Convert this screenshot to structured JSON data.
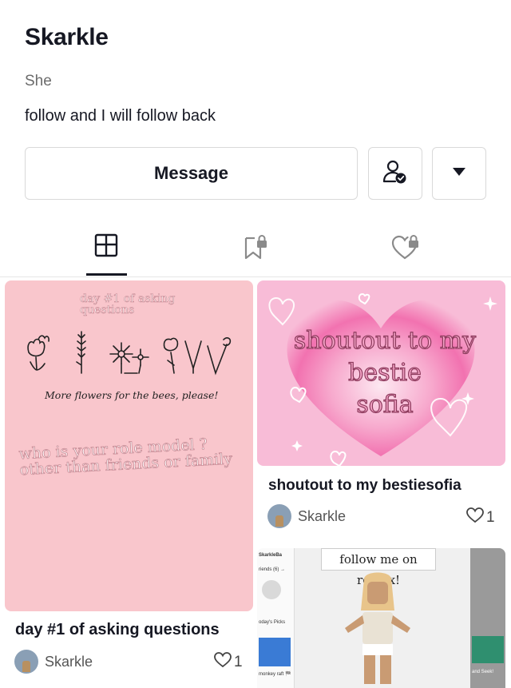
{
  "profile": {
    "name": "Skarkle",
    "pronoun": "She",
    "bio": "follow and I will follow back"
  },
  "actions": {
    "message_label": "Message",
    "friend_icon": "user-check-icon",
    "more_icon": "caret-down-icon"
  },
  "tabs": [
    {
      "icon": "grid-icon",
      "active": true
    },
    {
      "icon": "bookmark-lock-icon",
      "active": false
    },
    {
      "icon": "heart-lock-icon",
      "active": false
    }
  ],
  "posts": [
    {
      "caption": "day #1 of asking questions",
      "author": "Skarkle",
      "likes": "1",
      "image_text": {
        "top": "day #1 of asking questions",
        "middle": "More flowers for the bees, please!",
        "bottom": "who is your role model ? other than friends or family"
      }
    },
    {
      "caption": "shoutout to my bestiesofia",
      "author": "Skarkle",
      "likes": "1",
      "image_text": {
        "line1": "shoutout to my",
        "line2": "bestie",
        "line3": "sofia"
      }
    },
    {
      "image_text": {
        "banner": "follow me on roblox!",
        "side1": "SkarkleBa",
        "side2": "riends (6) →",
        "side3": "oday's Picks",
        "side4": "monkey raft 🏁",
        "side5": "and Seek!"
      }
    }
  ],
  "colors": {
    "accent_dark": "#161823",
    "card1_bg": "#f9c6cc",
    "card2_bg": "#f7b6d2",
    "heart_pink": "#f272b0"
  }
}
